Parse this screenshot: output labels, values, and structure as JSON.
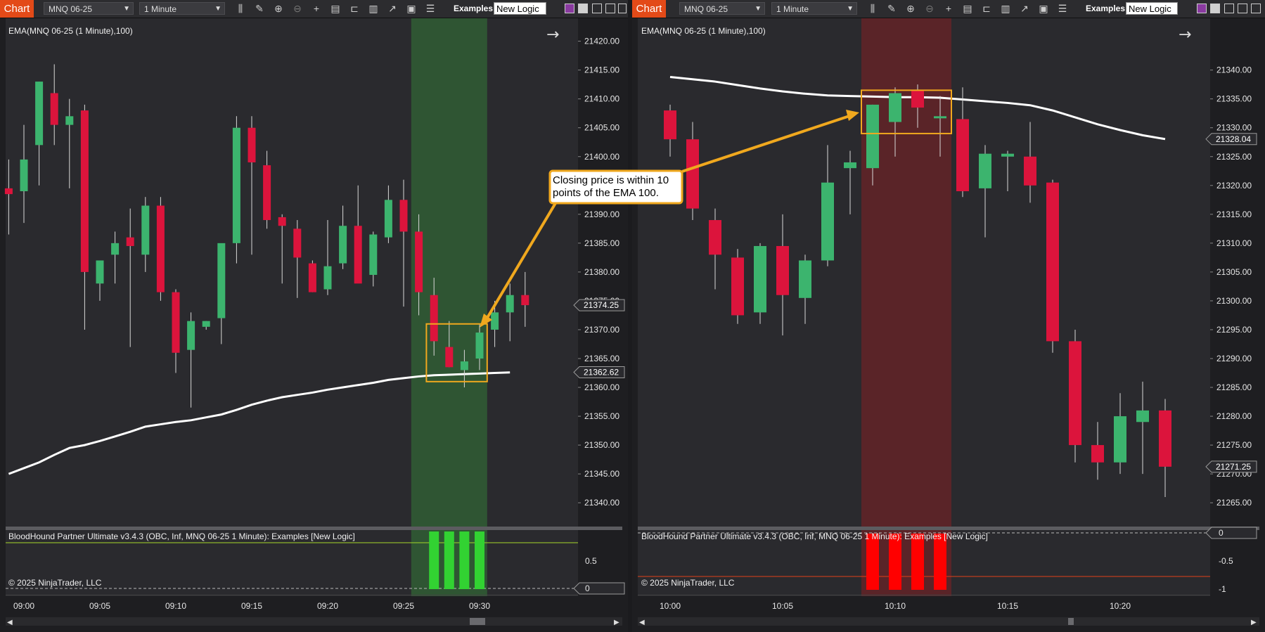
{
  "toolbar": {
    "chart_button": "Chart",
    "instrument": "MNQ 06-25",
    "interval": "1 Minute",
    "examples_label": "Examples",
    "logic_value": "New Logic"
  },
  "annotation": {
    "text_line1": "Closing price is within 10",
    "text_line2": "points of the EMA 100."
  },
  "colors": {
    "up": "#3cb46e",
    "down": "#dc143c",
    "green_zone": "#2f5533",
    "red_zone": "#5a2428",
    "box": "#f0a81e",
    "arrow": "#f0a81e",
    "ema": "#ffffff",
    "signal_green": "#32d232",
    "signal_red": "#ff0000"
  },
  "chart_data": [
    {
      "type": "candlestick",
      "title": "EMA(MNQ 06-25 (1 Minute),100)",
      "x_ticks": [
        "09:00",
        "09:05",
        "09:10",
        "09:15",
        "09:20",
        "09:25",
        "09:30"
      ],
      "ylim": [
        21336,
        21423
      ],
      "y_ticks": [
        21340.0,
        21345.0,
        21350.0,
        21355.0,
        21360.0,
        21365.0,
        21370.0,
        21375.0,
        21380.0,
        21385.0,
        21390.0,
        21395.0,
        21400.0,
        21405.0,
        21410.0,
        21415.0,
        21420.0
      ],
      "price_markers": [
        "21374.25",
        "21362.62"
      ],
      "candles": [
        {
          "t": "08:59",
          "o": 21394.5,
          "h": 21399.5,
          "l": 21386.5,
          "c": 21393.5
        },
        {
          "t": "09:00",
          "o": 21394.0,
          "h": 21405.5,
          "l": 21388.5,
          "c": 21399.5
        },
        {
          "t": "09:01",
          "o": 21402.0,
          "h": 21413.0,
          "l": 21395.0,
          "c": 21413.0
        },
        {
          "t": "09:02",
          "o": 21411.0,
          "h": 21416.0,
          "l": 21402.0,
          "c": 21405.5
        },
        {
          "t": "09:03",
          "o": 21405.5,
          "h": 21410.0,
          "l": 21394.5,
          "c": 21407.0
        },
        {
          "t": "09:04",
          "o": 21408.0,
          "h": 21409.0,
          "l": 21370.0,
          "c": 21380.0
        },
        {
          "t": "09:05",
          "o": 21378.0,
          "h": 21381.5,
          "l": 21375.0,
          "c": 21382.0
        },
        {
          "t": "09:06",
          "o": 21383.0,
          "h": 21387.0,
          "l": 21378.0,
          "c": 21385.0
        },
        {
          "t": "09:07",
          "o": 21386.0,
          "h": 21391.0,
          "l": 21367.0,
          "c": 21384.5
        },
        {
          "t": "09:08",
          "o": 21383.0,
          "h": 21393.0,
          "l": 21380.0,
          "c": 21391.5
        },
        {
          "t": "09:09",
          "o": 21391.5,
          "h": 21393.0,
          "l": 21375.0,
          "c": 21376.5
        },
        {
          "t": "09:10",
          "o": 21376.5,
          "h": 21377.0,
          "l": 21362.5,
          "c": 21366.0
        },
        {
          "t": "09:11",
          "o": 21366.5,
          "h": 21373.0,
          "l": 21356.5,
          "c": 21371.5
        },
        {
          "t": "09:12",
          "o": 21370.5,
          "h": 21371.5,
          "l": 21370.0,
          "c": 21371.5
        },
        {
          "t": "09:13",
          "o": 21372.0,
          "h": 21380.5,
          "l": 21367.5,
          "c": 21385.0
        },
        {
          "t": "09:14",
          "o": 21385.0,
          "h": 21407.0,
          "l": 21381.5,
          "c": 21405.0
        },
        {
          "t": "09:15",
          "o": 21405.0,
          "h": 21407.0,
          "l": 21383.0,
          "c": 21399.0
        },
        {
          "t": "09:16",
          "o": 21398.5,
          "h": 21401.0,
          "l": 21387.5,
          "c": 21389.0
        },
        {
          "t": "09:17",
          "o": 21389.5,
          "h": 21390.0,
          "l": 21378.0,
          "c": 21388.0
        },
        {
          "t": "09:18",
          "o": 21387.5,
          "h": 21389.0,
          "l": 21375.5,
          "c": 21382.5
        },
        {
          "t": "09:19",
          "o": 21381.5,
          "h": 21382.0,
          "l": 21376.5,
          "c": 21376.5
        },
        {
          "t": "09:20",
          "o": 21377.0,
          "h": 21389.0,
          "l": 21376.0,
          "c": 21381.0
        },
        {
          "t": "09:21",
          "o": 21381.5,
          "h": 21391.5,
          "l": 21380.5,
          "c": 21388.0
        },
        {
          "t": "09:22",
          "o": 21388.0,
          "h": 21395.0,
          "l": 21379.0,
          "c": 21378.0
        },
        {
          "t": "09:23",
          "o": 21379.5,
          "h": 21387.0,
          "l": 21377.5,
          "c": 21386.5
        },
        {
          "t": "09:24",
          "o": 21386.0,
          "h": 21395.0,
          "l": 21385.0,
          "c": 21392.5
        },
        {
          "t": "09:25",
          "o": 21392.5,
          "h": 21396.0,
          "l": 21374.0,
          "c": 21387.0
        },
        {
          "t": "09:26",
          "o": 21387.0,
          "h": 21390.0,
          "l": 21372.5,
          "c": 21376.5
        },
        {
          "t": "09:27",
          "o": 21376.0,
          "h": 21379.0,
          "l": 21365.5,
          "c": 21368.0
        },
        {
          "t": "09:28",
          "o": 21367.0,
          "h": 21371.5,
          "l": 21363.5,
          "c": 21363.5
        },
        {
          "t": "09:29",
          "o": 21363.0,
          "h": 21366.5,
          "l": 21360.0,
          "c": 21364.5
        },
        {
          "t": "09:30",
          "o": 21365.0,
          "h": 21371.0,
          "l": 21363.0,
          "c": 21369.5
        },
        {
          "t": "09:31",
          "o": 21370.0,
          "h": 21375.0,
          "l": 21367.0,
          "c": 21373.0
        },
        {
          "t": "09:32",
          "o": 21373.0,
          "h": 21378.0,
          "l": 21368.0,
          "c": 21376.0
        },
        {
          "t": "09:33",
          "o": 21376.0,
          "h": 21380.0,
          "l": 21370.5,
          "c": 21374.25
        }
      ],
      "ema": [
        21345.0,
        21346.0,
        21347.0,
        21348.3,
        21349.5,
        21350.0,
        21350.7,
        21351.5,
        21352.3,
        21353.2,
        21353.6,
        21354.0,
        21354.3,
        21354.8,
        21355.3,
        21356.1,
        21357.0,
        21357.7,
        21358.3,
        21358.7,
        21359.1,
        21359.6,
        21360.0,
        21360.4,
        21360.8,
        21361.3,
        21361.6,
        21361.9,
        21362.1,
        21362.2,
        21362.3,
        21362.4,
        21362.5,
        21362.6
      ],
      "signal_zone": {
        "start": "09:26",
        "end": "09:30",
        "color": "green"
      },
      "box": {
        "start": "09:27",
        "end": "09:30",
        "top": 21371.0,
        "bottom": 21361.0
      },
      "indicator": {
        "label": "BloodHound Partner Ultimate v3.4.3 (OBC, Inf, MNQ 06-25 1 Minute): Examples  [New Logic]",
        "y_ticks": [
          "0.5",
          "0"
        ],
        "bars": [
          {
            "t": "09:27",
            "v": 1
          },
          {
            "t": "09:28",
            "v": 1
          },
          {
            "t": "09:29",
            "v": 1
          },
          {
            "t": "09:30",
            "v": 1
          }
        ],
        "copyright": "© 2025 NinjaTrader, LLC"
      }
    },
    {
      "type": "candlestick",
      "title": "EMA(MNQ 06-25 (1 Minute),100)",
      "x_ticks": [
        "10:00",
        "10:05",
        "10:10",
        "10:15",
        "10:20"
      ],
      "ylim": [
        21261,
        21348
      ],
      "y_ticks": [
        21265.0,
        21270.0,
        21275.0,
        21280.0,
        21285.0,
        21290.0,
        21295.0,
        21300.0,
        21305.0,
        21310.0,
        21315.0,
        21320.0,
        21325.0,
        21330.0,
        21335.0,
        21340.0
      ],
      "price_markers": [
        "21328.04",
        "21271.25"
      ],
      "candles": [
        {
          "t": "10:00",
          "o": 21333.0,
          "h": 21334.0,
          "l": 21325.0,
          "c": 21328.0
        },
        {
          "t": "10:01",
          "o": 21328.0,
          "h": 21331.0,
          "l": 21314.0,
          "c": 21316.0
        },
        {
          "t": "10:02",
          "o": 21314.0,
          "h": 21316.0,
          "l": 21302.0,
          "c": 21308.0
        },
        {
          "t": "10:03",
          "o": 21307.5,
          "h": 21309.0,
          "l": 21296.0,
          "c": 21297.5
        },
        {
          "t": "10:04",
          "o": 21298.0,
          "h": 21310.0,
          "l": 21296.0,
          "c": 21309.5
        },
        {
          "t": "10:05",
          "o": 21309.5,
          "h": 21315.0,
          "l": 21294.0,
          "c": 21301.0
        },
        {
          "t": "10:06",
          "o": 21300.5,
          "h": 21308.0,
          "l": 21296.0,
          "c": 21307.0
        },
        {
          "t": "10:07",
          "o": 21307.0,
          "h": 21327.0,
          "l": 21306.0,
          "c": 21320.5
        },
        {
          "t": "10:08",
          "o": 21323.0,
          "h": 21326.0,
          "l": 21315.0,
          "c": 21324.0
        },
        {
          "t": "10:09",
          "o": 21323.0,
          "h": 21334.0,
          "l": 21320.0,
          "c": 21334.0
        },
        {
          "t": "10:10",
          "o": 21331.0,
          "h": 21337.0,
          "l": 21325.0,
          "c": 21336.0
        },
        {
          "t": "10:11",
          "o": 21336.5,
          "h": 21337.5,
          "l": 21330.0,
          "c": 21333.5
        },
        {
          "t": "10:12",
          "o": 21332.0,
          "h": 21335.5,
          "l": 21325.0,
          "c": 21332.0
        },
        {
          "t": "10:13",
          "o": 21331.5,
          "h": 21337.0,
          "l": 21318.0,
          "c": 21319.0
        },
        {
          "t": "10:14",
          "o": 21319.5,
          "h": 21327.0,
          "l": 21311.0,
          "c": 21325.5
        },
        {
          "t": "10:15",
          "o": 21325.0,
          "h": 21326.0,
          "l": 21319.0,
          "c": 21325.5
        },
        {
          "t": "10:16",
          "o": 21325.0,
          "h": 21331.0,
          "l": 21317.0,
          "c": 21320.0
        },
        {
          "t": "10:17",
          "o": 21320.5,
          "h": 21321.0,
          "l": 21291.0,
          "c": 21293.0
        },
        {
          "t": "10:18",
          "o": 21293.0,
          "h": 21295.0,
          "l": 21272.0,
          "c": 21275.0
        },
        {
          "t": "10:19",
          "o": 21275.0,
          "h": 21279.0,
          "l": 21269.0,
          "c": 21272.0
        },
        {
          "t": "10:20",
          "o": 21272.0,
          "h": 21284.0,
          "l": 21270.0,
          "c": 21280.0
        },
        {
          "t": "10:21",
          "o": 21279.0,
          "h": 21286.0,
          "l": 21270.0,
          "c": 21281.0
        },
        {
          "t": "10:22",
          "o": 21281.0,
          "h": 21283.0,
          "l": 21266.0,
          "c": 21271.25
        }
      ],
      "ema": [
        21338.8,
        21338.4,
        21338.0,
        21337.4,
        21336.8,
        21336.3,
        21335.9,
        21335.6,
        21335.5,
        21335.4,
        21335.3,
        21335.3,
        21335.2,
        21334.9,
        21334.6,
        21334.3,
        21333.9,
        21333.0,
        21331.8,
        21330.6,
        21329.6,
        21328.7,
        21328.04
      ],
      "signal_zone": {
        "start": "10:09",
        "end": "10:12",
        "color": "red"
      },
      "box": {
        "start": "10:09",
        "end": "10:12",
        "top": 21336.5,
        "bottom": 21329.0
      },
      "indicator": {
        "label": "BloodHound Partner Ultimate v3.4.3 (OBC, Inf, MNQ 06-25 1 Minute): Examples  [New Logic]",
        "y_ticks": [
          "0",
          "-0.5",
          "-1"
        ],
        "bars": [
          {
            "t": "10:09",
            "v": -1
          },
          {
            "t": "10:10",
            "v": -1
          },
          {
            "t": "10:11",
            "v": -1
          },
          {
            "t": "10:12",
            "v": -1
          }
        ],
        "copyright": "© 2025 NinjaTrader, LLC"
      }
    }
  ]
}
